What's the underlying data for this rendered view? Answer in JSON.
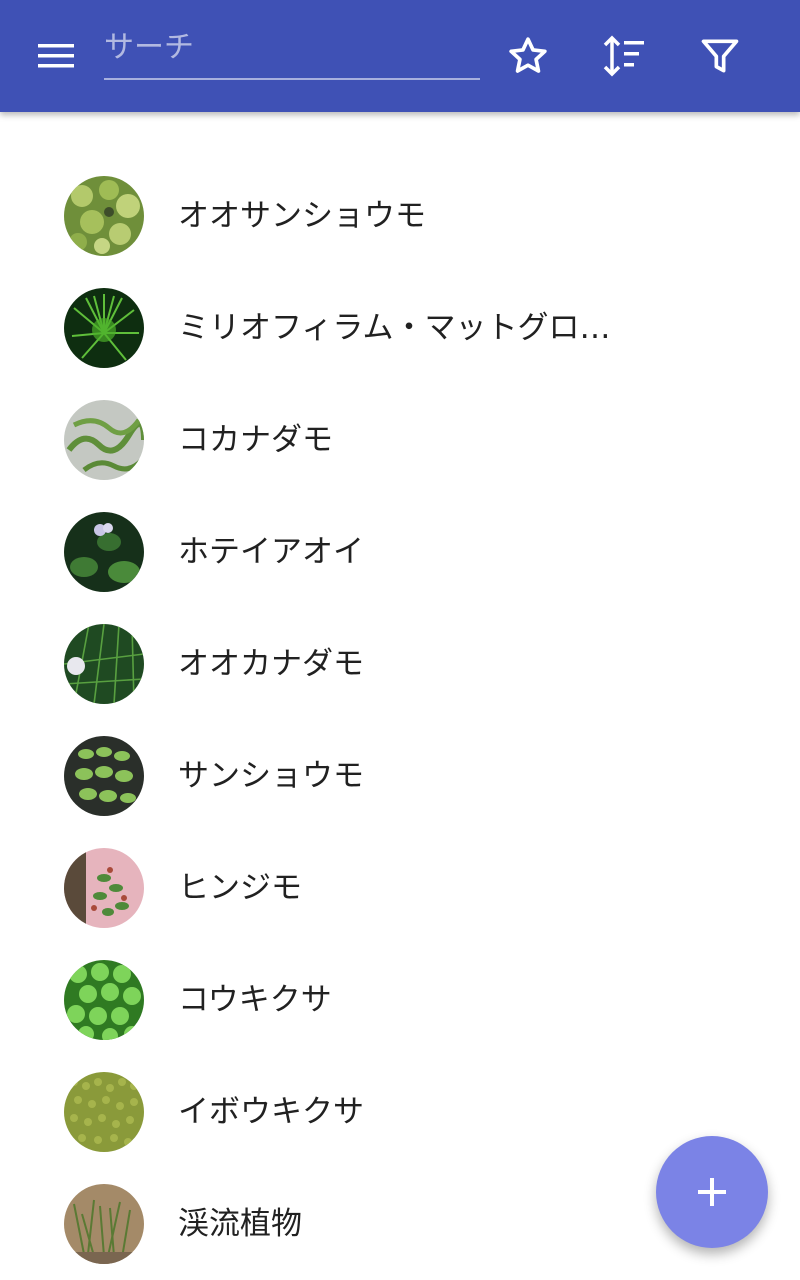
{
  "header": {
    "search": {
      "placeholder": "サーチ",
      "value": ""
    },
    "icons": [
      "menu-icon",
      "star-icon",
      "sort-icon",
      "filter-icon"
    ],
    "color": "#3f51b5"
  },
  "plants": [
    {
      "name": "オオサンショウモ",
      "thumb_color": "#8fae4a"
    },
    {
      "name": "ミリオフィラム・マットグロッソ",
      "thumb_color": "#3d8f2a"
    },
    {
      "name": "コカナダモ",
      "thumb_color": "#9fb58c"
    },
    {
      "name": "ホテイアオイ",
      "thumb_color": "#1f4d25"
    },
    {
      "name": "オオカナダモ",
      "thumb_color": "#2f6a2c"
    },
    {
      "name": "サンショウモ",
      "thumb_color": "#7cae4a"
    },
    {
      "name": "ヒンジモ",
      "thumb_color": "#c9858f"
    },
    {
      "name": "コウキクサ",
      "thumb_color": "#52a335"
    },
    {
      "name": "イボウキクサ",
      "thumb_color": "#8fa040"
    },
    {
      "name": "渓流植物",
      "thumb_color": "#9a8060"
    }
  ],
  "fab": {
    "icon": "plus-icon",
    "color": "#7b83e6"
  }
}
